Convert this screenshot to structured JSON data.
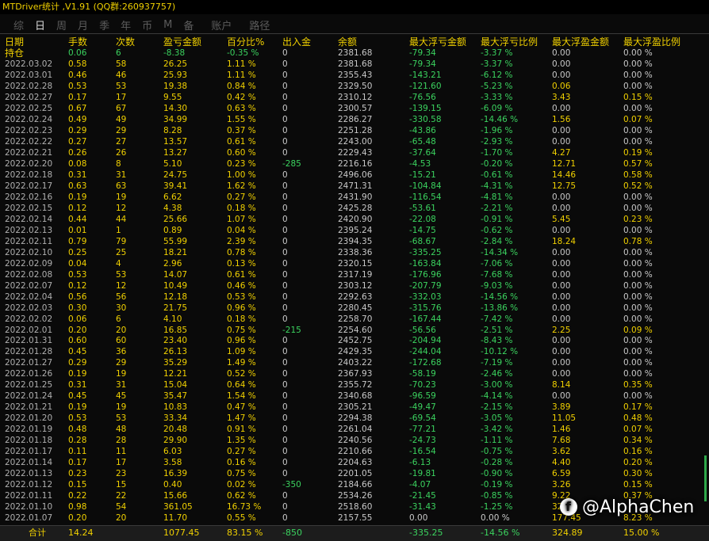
{
  "window": {
    "title": "MTDriver统计 ,V1.91 (QQ群:260937757)"
  },
  "tabs": [
    {
      "label": "综",
      "active": false
    },
    {
      "label": "日",
      "active": true
    },
    {
      "label": "周",
      "active": false
    },
    {
      "label": "月",
      "active": false
    },
    {
      "label": "季",
      "active": false
    },
    {
      "label": "年",
      "active": false
    },
    {
      "label": "币",
      "active": false
    },
    {
      "label": "M",
      "active": false
    },
    {
      "label": "备",
      "active": false
    },
    {
      "label": "账户",
      "active": false
    },
    {
      "label": "路径",
      "active": false
    }
  ],
  "columns": [
    "日期",
    "手数",
    "次数",
    "盈亏金额",
    "百分比%",
    "出入金",
    "余额",
    "最大浮亏金额",
    "最大浮亏比例",
    "最大浮盈金额",
    "最大浮盈比例"
  ],
  "holding": [
    "持仓",
    "0.06",
    "6",
    "-8.38",
    "-0.35 %",
    "0",
    "2381.68",
    "-79.34",
    "-3.37 %",
    "0.00",
    "0.00 %"
  ],
  "rows": [
    [
      "2022.03.02",
      "0.58",
      "58",
      "26.25",
      "1.11 %",
      "0",
      "2381.68",
      "-79.34",
      "-3.37 %",
      "0.00",
      "0.00 %"
    ],
    [
      "2022.03.01",
      "0.46",
      "46",
      "25.93",
      "1.11 %",
      "0",
      "2355.43",
      "-143.21",
      "-6.12 %",
      "0.00",
      "0.00 %"
    ],
    [
      "2022.02.28",
      "0.53",
      "53",
      "19.38",
      "0.84 %",
      "0",
      "2329.50",
      "-121.60",
      "-5.23 %",
      "0.06",
      "0.00 %"
    ],
    [
      "2022.02.27",
      "0.17",
      "17",
      "9.55",
      "0.42 %",
      "0",
      "2310.12",
      "-76.56",
      "-3.33 %",
      "3.43",
      "0.15 %"
    ],
    [
      "2022.02.25",
      "0.67",
      "67",
      "14.30",
      "0.63 %",
      "0",
      "2300.57",
      "-139.15",
      "-6.09 %",
      "0.00",
      "0.00 %"
    ],
    [
      "2022.02.24",
      "0.49",
      "49",
      "34.99",
      "1.55 %",
      "0",
      "2286.27",
      "-330.58",
      "-14.46 %",
      "1.56",
      "0.07 %"
    ],
    [
      "2022.02.23",
      "0.29",
      "29",
      "8.28",
      "0.37 %",
      "0",
      "2251.28",
      "-43.86",
      "-1.96 %",
      "0.00",
      "0.00 %"
    ],
    [
      "2022.02.22",
      "0.27",
      "27",
      "13.57",
      "0.61 %",
      "0",
      "2243.00",
      "-65.48",
      "-2.93 %",
      "0.00",
      "0.00 %"
    ],
    [
      "2022.02.21",
      "0.26",
      "26",
      "13.27",
      "0.60 %",
      "0",
      "2229.43",
      "-37.64",
      "-1.70 %",
      "4.27",
      "0.19 %"
    ],
    [
      "2022.02.20",
      "0.08",
      "8",
      "5.10",
      "0.23 %",
      "-285",
      "2216.16",
      "-4.53",
      "-0.20 %",
      "12.71",
      "0.57 %"
    ],
    [
      "2022.02.18",
      "0.31",
      "31",
      "24.75",
      "1.00 %",
      "0",
      "2496.06",
      "-15.21",
      "-0.61 %",
      "14.46",
      "0.58 %"
    ],
    [
      "2022.02.17",
      "0.63",
      "63",
      "39.41",
      "1.62 %",
      "0",
      "2471.31",
      "-104.84",
      "-4.31 %",
      "12.75",
      "0.52 %"
    ],
    [
      "2022.02.16",
      "0.19",
      "19",
      "6.62",
      "0.27 %",
      "0",
      "2431.90",
      "-116.54",
      "-4.81 %",
      "0.00",
      "0.00 %"
    ],
    [
      "2022.02.15",
      "0.12",
      "12",
      "4.38",
      "0.18 %",
      "0",
      "2425.28",
      "-53.61",
      "-2.21 %",
      "0.00",
      "0.00 %"
    ],
    [
      "2022.02.14",
      "0.44",
      "44",
      "25.66",
      "1.07 %",
      "0",
      "2420.90",
      "-22.08",
      "-0.91 %",
      "5.45",
      "0.23 %"
    ],
    [
      "2022.02.13",
      "0.01",
      "1",
      "0.89",
      "0.04 %",
      "0",
      "2395.24",
      "-14.75",
      "-0.62 %",
      "0.00",
      "0.00 %"
    ],
    [
      "2022.02.11",
      "0.79",
      "79",
      "55.99",
      "2.39 %",
      "0",
      "2394.35",
      "-68.67",
      "-2.84 %",
      "18.24",
      "0.78 %"
    ],
    [
      "2022.02.10",
      "0.25",
      "25",
      "18.21",
      "0.78 %",
      "0",
      "2338.36",
      "-335.25",
      "-14.34 %",
      "0.00",
      "0.00 %"
    ],
    [
      "2022.02.09",
      "0.04",
      "4",
      "2.96",
      "0.13 %",
      "0",
      "2320.15",
      "-163.84",
      "-7.06 %",
      "0.00",
      "0.00 %"
    ],
    [
      "2022.02.08",
      "0.53",
      "53",
      "14.07",
      "0.61 %",
      "0",
      "2317.19",
      "-176.96",
      "-7.68 %",
      "0.00",
      "0.00 %"
    ],
    [
      "2022.02.07",
      "0.12",
      "12",
      "10.49",
      "0.46 %",
      "0",
      "2303.12",
      "-207.79",
      "-9.03 %",
      "0.00",
      "0.00 %"
    ],
    [
      "2022.02.04",
      "0.56",
      "56",
      "12.18",
      "0.53 %",
      "0",
      "2292.63",
      "-332.03",
      "-14.56 %",
      "0.00",
      "0.00 %"
    ],
    [
      "2022.02.03",
      "0.30",
      "30",
      "21.75",
      "0.96 %",
      "0",
      "2280.45",
      "-315.76",
      "-13.86 %",
      "0.00",
      "0.00 %"
    ],
    [
      "2022.02.02",
      "0.06",
      "6",
      "4.10",
      "0.18 %",
      "0",
      "2258.70",
      "-167.44",
      "-7.42 %",
      "0.00",
      "0.00 %"
    ],
    [
      "2022.02.01",
      "0.20",
      "20",
      "16.85",
      "0.75 %",
      "-215",
      "2254.60",
      "-56.56",
      "-2.51 %",
      "2.25",
      "0.09 %"
    ],
    [
      "2022.01.31",
      "0.60",
      "60",
      "23.40",
      "0.96 %",
      "0",
      "2452.75",
      "-204.94",
      "-8.43 %",
      "0.00",
      "0.00 %"
    ],
    [
      "2022.01.28",
      "0.45",
      "36",
      "26.13",
      "1.09 %",
      "0",
      "2429.35",
      "-244.04",
      "-10.12 %",
      "0.00",
      "0.00 %"
    ],
    [
      "2022.01.27",
      "0.29",
      "29",
      "35.29",
      "1.49 %",
      "0",
      "2403.22",
      "-172.68",
      "-7.19 %",
      "0.00",
      "0.00 %"
    ],
    [
      "2022.01.26",
      "0.19",
      "19",
      "12.21",
      "0.52 %",
      "0",
      "2367.93",
      "-58.19",
      "-2.46 %",
      "0.00",
      "0.00 %"
    ],
    [
      "2022.01.25",
      "0.31",
      "31",
      "15.04",
      "0.64 %",
      "0",
      "2355.72",
      "-70.23",
      "-3.00 %",
      "8.14",
      "0.35 %"
    ],
    [
      "2022.01.24",
      "0.45",
      "45",
      "35.47",
      "1.54 %",
      "0",
      "2340.68",
      "-96.59",
      "-4.14 %",
      "0.00",
      "0.00 %"
    ],
    [
      "2022.01.21",
      "0.19",
      "19",
      "10.83",
      "0.47 %",
      "0",
      "2305.21",
      "-49.47",
      "-2.15 %",
      "3.89",
      "0.17 %"
    ],
    [
      "2022.01.20",
      "0.53",
      "53",
      "33.34",
      "1.47 %",
      "0",
      "2294.38",
      "-69.54",
      "-3.05 %",
      "11.05",
      "0.48 %"
    ],
    [
      "2022.01.19",
      "0.48",
      "48",
      "20.48",
      "0.91 %",
      "0",
      "2261.04",
      "-77.21",
      "-3.42 %",
      "1.46",
      "0.07 %"
    ],
    [
      "2022.01.18",
      "0.28",
      "28",
      "29.90",
      "1.35 %",
      "0",
      "2240.56",
      "-24.73",
      "-1.11 %",
      "7.68",
      "0.34 %"
    ],
    [
      "2022.01.17",
      "0.11",
      "11",
      "6.03",
      "0.27 %",
      "0",
      "2210.66",
      "-16.54",
      "-0.75 %",
      "3.62",
      "0.16 %"
    ],
    [
      "2022.01.14",
      "0.17",
      "17",
      "3.58",
      "0.16 %",
      "0",
      "2204.63",
      "-6.13",
      "-0.28 %",
      "4.40",
      "0.20 %"
    ],
    [
      "2022.01.13",
      "0.23",
      "23",
      "16.39",
      "0.75 %",
      "0",
      "2201.05",
      "-19.81",
      "-0.90 %",
      "6.59",
      "0.30 %"
    ],
    [
      "2022.01.12",
      "0.15",
      "15",
      "0.40",
      "0.02 %",
      "-350",
      "2184.66",
      "-4.07",
      "-0.19 %",
      "3.26",
      "0.15 %"
    ],
    [
      "2022.01.11",
      "0.22",
      "22",
      "15.66",
      "0.62 %",
      "0",
      "2534.26",
      "-21.45",
      "-0.85 %",
      "9.22",
      "0.37 %"
    ],
    [
      "2022.01.10",
      "0.98",
      "54",
      "361.05",
      "16.73 %",
      "0",
      "2518.60",
      "-31.43",
      "-1.25 %",
      "32",
      ""
    ],
    [
      "2022.01.07",
      "0.20",
      "20",
      "11.70",
      "0.55 %",
      "0",
      "2157.55",
      "0.00",
      "0.00 %",
      "177.45",
      "8.23 %"
    ]
  ],
  "summary": [
    "合计",
    "14.24",
    "",
    "1077.45",
    "83.15 %",
    "-850",
    "",
    "-335.25",
    "-14.56 %",
    "324.89",
    "15.00 %"
  ],
  "watermark": {
    "icon": "facebook-icon",
    "text": "@AlphaChen"
  },
  "colors": {
    "title": "#f0d000",
    "header": "#f0d000",
    "positive": "#f0d000",
    "negative": "#3bd35f",
    "neutral": "#c8c8c8",
    "background": "#0a0a0a"
  }
}
